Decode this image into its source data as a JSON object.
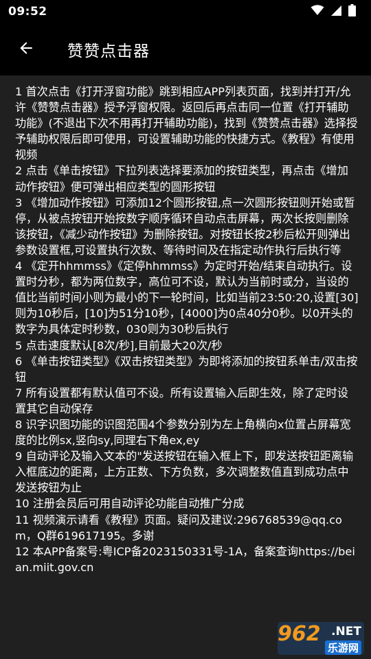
{
  "status": {
    "time": "09:52"
  },
  "header": {
    "title": "赞赞点击器"
  },
  "paragraphs": [
    "1 首次点击《打开浮窗功能》跳到相应APP列表页面，找到并打开/允许《赞赞点击器》授予浮窗权限。返回后再点击同一位置《打开辅助功能》(不退出下次不用再打开辅助功能)，找到《赞赞点击器》选择授予辅助权限后即可使用，可设置辅助功能的快捷方式。《教程》有使用视频",
    "2 点击《单击按钮》下拉列表选择要添加的按钮类型，再点击《增加动作按钮》便可弹出相应类型的圆形按钮",
    "3 《增加动作按钮》可添加12个圆形按钮,点一次圆形按钮则开始或暂停，从被点按钮开始按数字顺序循环自动点击屏幕，两次长按则删除该按钮，《减少动作按钮》为删除按钮。对按钮长按2秒后松开则弹出参数设置框,可设置执行次数、等待时间及在指定动作执行后执行等",
    "4 《定开hhmmss》《定停hhmmss》为定时开始/结束自动执行。设置时分秒，都为两位数字，高位可不设，默认为当前时或分，当设的值比当前时间小则为最小的下一轮时间，比如当前23:50:20,设置[30]则为10秒后，[10]为51分10秒，[4000]为0点40分0秒。以0开头的数字为具体定时秒数，030则为30秒后执行",
    "5 点击速度默认[8次/秒],目前最大20次/秒",
    "6 《单击按钮类型》《双击按钮类型》为即将添加的按钮系单击/双击按钮",
    "7 所有设置都有默认值可不设。所有设置输入后即生效，除了定时设置其它自动保存",
    "8 识字识图功能的识图范围4个参数分别为左上角横向x位置占屏幕宽度的比例sx,竖向sy,同理右下角ex,ey",
    "9 自动评论及输入文本的\"发送按钮在输入框上下，即发送按钮距离输入框底边的距离，上方正数、下方负数，多次调整数值直到成功点中发送按钮为止",
    "10 注册会员后可用自动评论功能自动推广分成",
    "11 视频演示请看《教程》页面。疑问及建议:296768539@qq.com，Q群619617195。多谢",
    "12 本APP备案号:粤ICP备2023150331号-1A，备案查询https://beian.miit.gov.cn"
  ],
  "watermark": {
    "number": "962",
    "suffix": ".NET",
    "site": "乐游网"
  },
  "icons": {
    "back": "arrow-left-icon",
    "wifi": "wifi-icon",
    "signal": "signal-icon",
    "battery": "battery-icon"
  },
  "colors": {
    "background": "#202020",
    "bar": "#000000",
    "text": "#ffffff",
    "watermark_orange": "#f39a1e",
    "watermark_blue": "#1b6fd0"
  }
}
